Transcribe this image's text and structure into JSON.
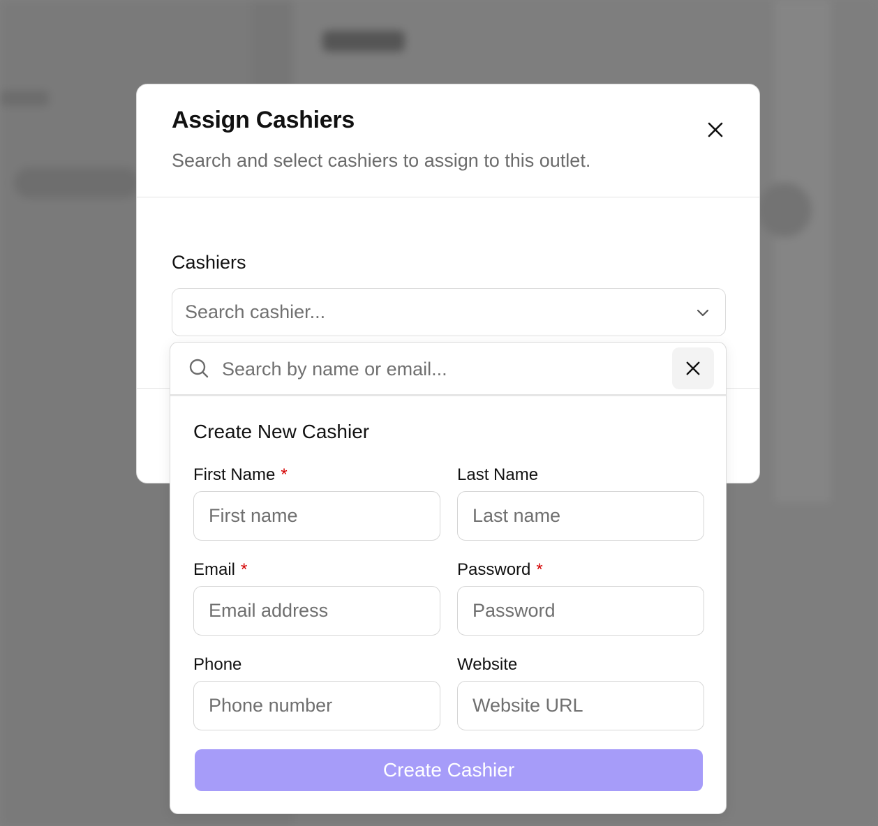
{
  "modal": {
    "title": "Assign Cashiers",
    "subtitle": "Search and select cashiers to assign to this outlet.",
    "cashiers_label": "Cashiers",
    "select_placeholder": "Search cashier..."
  },
  "dropdown": {
    "search_placeholder": "Search by name or email...",
    "create_title": "Create New Cashier",
    "fields": {
      "first_name": {
        "label": "First Name",
        "placeholder": "First name",
        "required": "*"
      },
      "last_name": {
        "label": "Last Name",
        "placeholder": "Last name"
      },
      "email": {
        "label": "Email",
        "placeholder": "Email address",
        "required": "*"
      },
      "password": {
        "label": "Password",
        "placeholder": "Password",
        "required": "*"
      },
      "phone": {
        "label": "Phone",
        "placeholder": "Phone number"
      },
      "website": {
        "label": "Website",
        "placeholder": "Website URL"
      }
    },
    "submit_label": "Create Cashier"
  },
  "colors": {
    "primary_button": "#a69cf9",
    "required_marker": "#d40000",
    "overlay": "#808080"
  },
  "icons": {
    "modal_close": "close-icon",
    "select_toggle": "chevron-down-icon",
    "search": "search-icon",
    "search_clear": "close-icon"
  }
}
